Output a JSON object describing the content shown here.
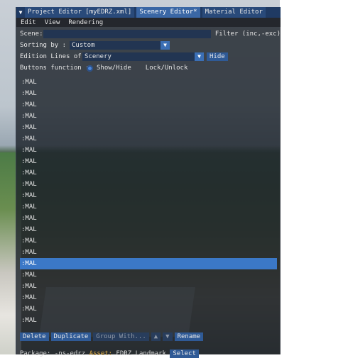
{
  "tabs": [
    {
      "label": "Project Editor [myEDRZ.xml]",
      "active": false
    },
    {
      "label": "Scenery Editor*",
      "active": true
    },
    {
      "label": "Material Editor",
      "active": false
    }
  ],
  "menu": [
    "Edit",
    "View",
    "Rendering"
  ],
  "scene": {
    "label": "Scene:",
    "value": "",
    "filter_label": "Filter (inc,-exc)"
  },
  "sorting": {
    "label": "Sorting by :",
    "value": "Custom"
  },
  "edition": {
    "label": "Edition Lines of",
    "value": "Scenery",
    "hide_button": "Hide"
  },
  "buttons_function": {
    "label": "Buttons function :",
    "option1": "Show/Hide",
    "option2": "Lock/Unlock"
  },
  "list_items": [
    ":MAL",
    ":MAL",
    ":MAL",
    ":MAL",
    ":MAL",
    ":MAL",
    ":MAL",
    ":MAL",
    ":MAL",
    ":MAL",
    ":MAL",
    ":MAL",
    ":MAL",
    ":MAL",
    ":MAL",
    ":MAL",
    ":MAL",
    ":MAL",
    ":MAL",
    ":MAL",
    ":MAL",
    ":MAL"
  ],
  "selected_index": 16,
  "actions": {
    "delete": "Delete",
    "duplicate": "Duplicate",
    "group_with": "Group With...",
    "up": "▲",
    "down": "▼",
    "rename": "Rename"
  },
  "status": {
    "package_label": "Package:",
    "package_value": "-ns-edrz",
    "asset_label": "Asset:",
    "asset_value": "EDRZ Landmark",
    "button": "Select"
  },
  "colors": {
    "accent": "#3b78c7",
    "tab_active": "#3a67a5",
    "asset": "#e3b047"
  }
}
